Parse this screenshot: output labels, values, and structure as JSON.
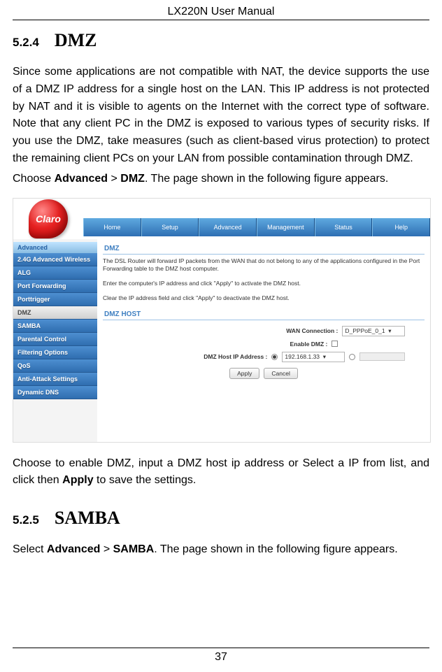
{
  "doc_title": "LX220N User Manual",
  "page_number": "37",
  "sections": {
    "dmz": {
      "num": "5.2.4",
      "title": "DMZ",
      "para1": "Since some applications are not compatible with NAT, the device supports the use of a DMZ IP address for a single host on the LAN. This IP address is not protected by NAT and it is visible to agents on the Internet with the correct type of software. Note that any client PC in the DMZ is exposed to various types of security risks. If you use the DMZ, take measures (such as client-based virus protection) to protect the remaining client PCs on your LAN from possible contamination through DMZ.",
      "para2_pre": "Choose ",
      "para2_b1": "Advanced",
      "para2_mid": " > ",
      "para2_b2": "DMZ",
      "para2_post": ". The page shown in the following figure appears.",
      "para3_pre": "Choose to enable DMZ, input a DMZ host ip address or Select a IP from list, and click then ",
      "para3_b": "Apply",
      "para3_post": " to save the settings."
    },
    "samba": {
      "num": "5.2.5",
      "title": "SAMBA",
      "p_pre": "Select ",
      "p_b1": "Advanced",
      "p_mid": " > ",
      "p_b2": "SAMBA",
      "p_post": ". The page shown in the following figure appears."
    }
  },
  "shot": {
    "logo": "Claro",
    "topnav": [
      "Home",
      "Setup",
      "Advanced",
      "Management",
      "Status",
      "Help"
    ],
    "sidebar_head": "Advanced",
    "sidebar": [
      "2.4G Advanced Wireless",
      "ALG",
      "Port Forwarding",
      "Porttrigger",
      "DMZ",
      "SAMBA",
      "Parental Control",
      "Filtering Options",
      "QoS",
      "Anti-Attack Settings",
      "Dynamic DNS"
    ],
    "sidebar_active_index": 4,
    "panel_title": "DMZ",
    "panel_text1": "The DSL Router will forward IP packets from the WAN that do not belong to any of the applications configured in the Port Forwarding table to the DMZ host computer.",
    "panel_text2": "Enter the computer's IP address and click \"Apply\" to activate the DMZ host.",
    "panel_text3": "Clear the IP address field and click \"Apply\" to deactivate the DMZ host.",
    "host_title": "DMZ HOST",
    "labels": {
      "wan": "WAN Connection :",
      "enable": "Enable DMZ :",
      "ip": "DMZ Host IP Address :"
    },
    "wan_value": "D_PPPoE_0_1",
    "ip_value": "192.168.1.33",
    "btn_apply": "Apply",
    "btn_cancel": "Cancel"
  }
}
